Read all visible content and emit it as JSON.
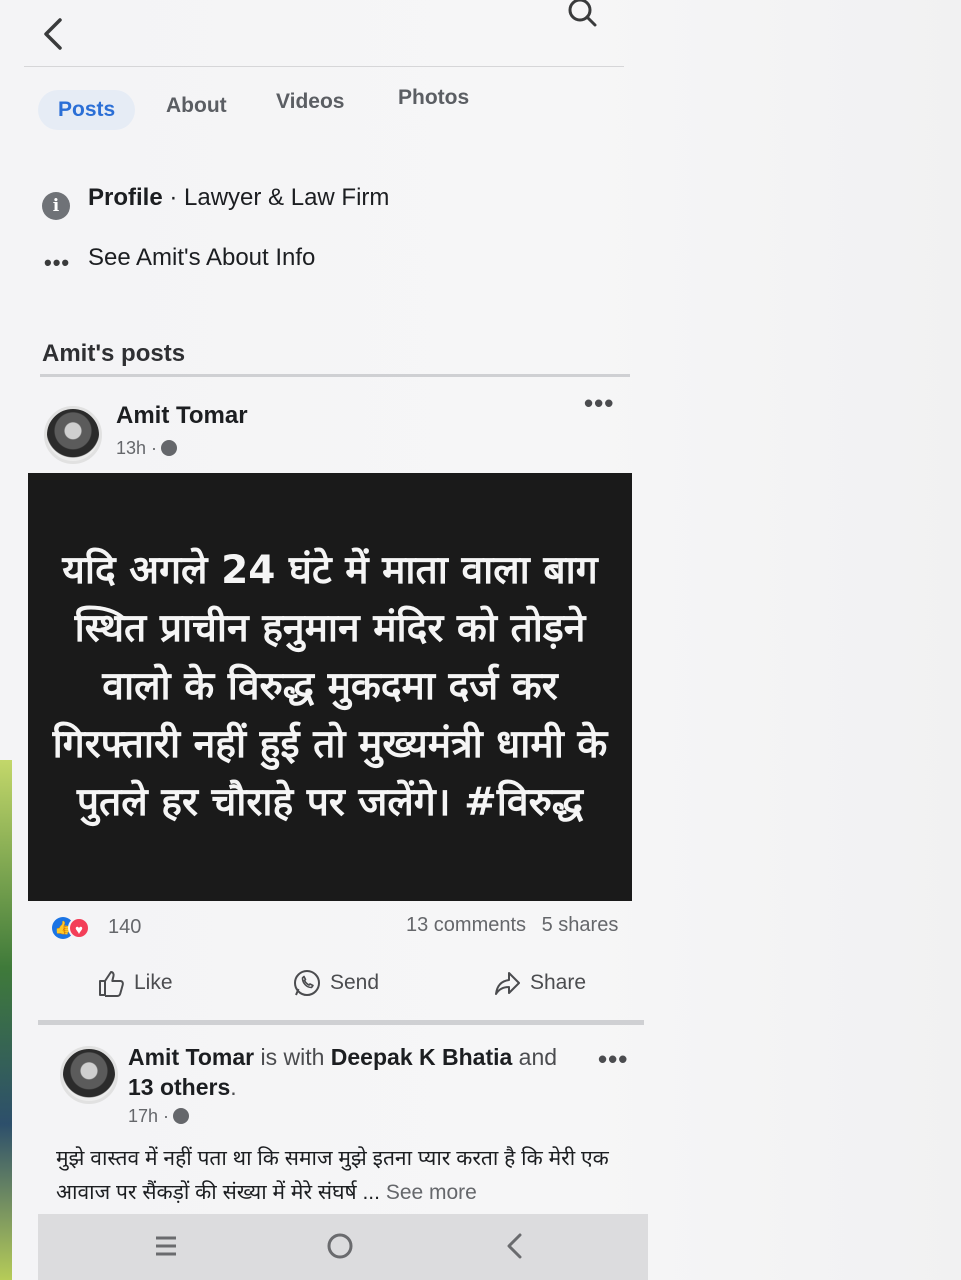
{
  "header": {
    "back_icon": "chevron-left-icon",
    "search_icon": "search-icon"
  },
  "tabs": [
    {
      "label": "Posts",
      "active": true
    },
    {
      "label": "About",
      "active": false
    },
    {
      "label": "Videos",
      "active": false
    },
    {
      "label": "Photos",
      "active": false
    }
  ],
  "intro": {
    "profile_label": "Profile",
    "profile_category": " · Lawyer & Law Firm",
    "about_link": "See Amit's About Info"
  },
  "posts_section": {
    "title": "Amit's posts"
  },
  "post1": {
    "author": "Amit Tomar",
    "time": "13h ·",
    "image_text": "यदि अगले 24 घंटे में माता वाला बाग स्थित प्राचीन हनुमान मंदिर को तोड़ने वालो के विरुद्ध मुकदमा दर्ज कर गिरफ्तारी नहीं हुई तो मुख्यमंत्री धामी के पुतले हर चौराहे पर जलेंगे। #विरुद्ध",
    "reaction_count": "140",
    "comments": "13 comments",
    "shares": "5 shares",
    "actions": {
      "like": "Like",
      "send": "Send",
      "share": "Share"
    }
  },
  "post2": {
    "author": "Amit Tomar",
    "with_text": " is with ",
    "tagged": "Deepak K Bhatia",
    "and_text": " and ",
    "others": "13 others",
    "period": ".",
    "time": "17h ·",
    "body": "मुझे वास्तव में नहीं पता था कि समाज मुझे इतना प्यार करता है कि मेरी एक आवाज पर सैंकड़ों की संख्या में मेरे संघर्ष ... ",
    "see_more": "See more"
  },
  "colors": {
    "accent": "#2b6fd6",
    "like_blue": "#1b74e4",
    "love_red": "#f33e58",
    "post_image_bg": "#1a1a1a"
  }
}
